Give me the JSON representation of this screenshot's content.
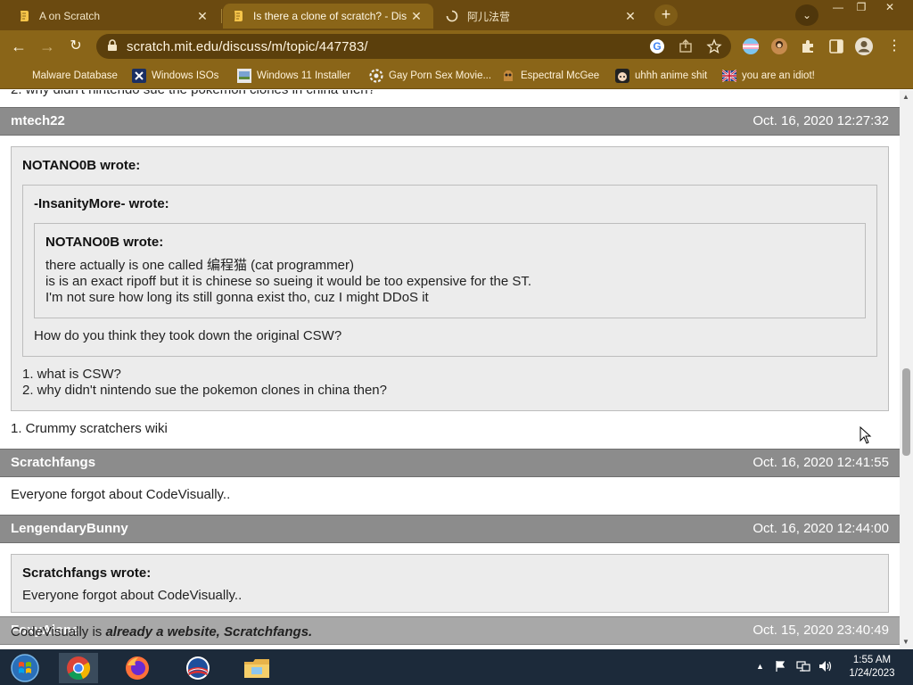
{
  "tabs": [
    {
      "title": "A on Scratch",
      "active": false
    },
    {
      "title": "Is there a clone of scratch? - Dis",
      "active": true
    },
    {
      "title": "阿儿法营",
      "active": false
    }
  ],
  "address": {
    "url": "scratch.mit.edu/discuss/m/topic/447783/"
  },
  "bookmarks": [
    "Malware Database",
    "Windows ISOs",
    "Windows 11 Installer",
    "Gay Porn Sex Movie...",
    "Espectral McGee",
    "uhhh anime shit",
    "you are an idiot!"
  ],
  "thread": {
    "top_cut": "2. why didn't nintendo sue the pokemon clones in china then?",
    "posts": [
      {
        "author": "mtech22",
        "date": "Oct. 16, 2020 12:27:32",
        "quote_outer_author": "NOTANO0B wrote:",
        "quote_mid_author": "-InsanityMore- wrote:",
        "quote_inner_author": "NOTANO0B wrote:",
        "quote_inner_lines": [
          "there actually is one called 编程猫 (cat programmer)",
          "is is an exact ripoff but it is chinese so sueing it would be too expensive for the ST.",
          "I'm not sure how long its still gonna exist tho, cuz I might DDoS it"
        ],
        "quote_mid_text": "How do you think they took down the original CSW?",
        "quote_outer_lines": [
          "1. what is CSW?",
          "2. why didn't nintendo sue the pokemon clones in china then?"
        ],
        "body": "1. Crummy scratchers wiki"
      },
      {
        "author": "Scratchfangs",
        "date": "Oct. 16, 2020 12:41:55",
        "body": "Everyone forgot about CodeVisually.."
      },
      {
        "author": "LengendaryBunny",
        "date": "Oct. 16, 2020 12:44:00",
        "quote_author": "Scratchfangs wrote:",
        "quote_text": "Everyone forgot about CodeVisually..",
        "body_plain": "CodeVisually is ",
        "body_emph": "already a website, Scratchfangs."
      },
      {
        "author": "FoxyAlone",
        "date": "Oct. 15, 2020 23:40:49"
      }
    ]
  },
  "taskbar": {
    "time": "1:55 AM",
    "date": "1/24/2023"
  },
  "colors": {
    "tab_strip": "#6b4a10",
    "toolbar": "#8a6518",
    "post_header": "#8c8c8c",
    "quote_bg": "#ececec",
    "taskbar": "#1c2a3a"
  }
}
